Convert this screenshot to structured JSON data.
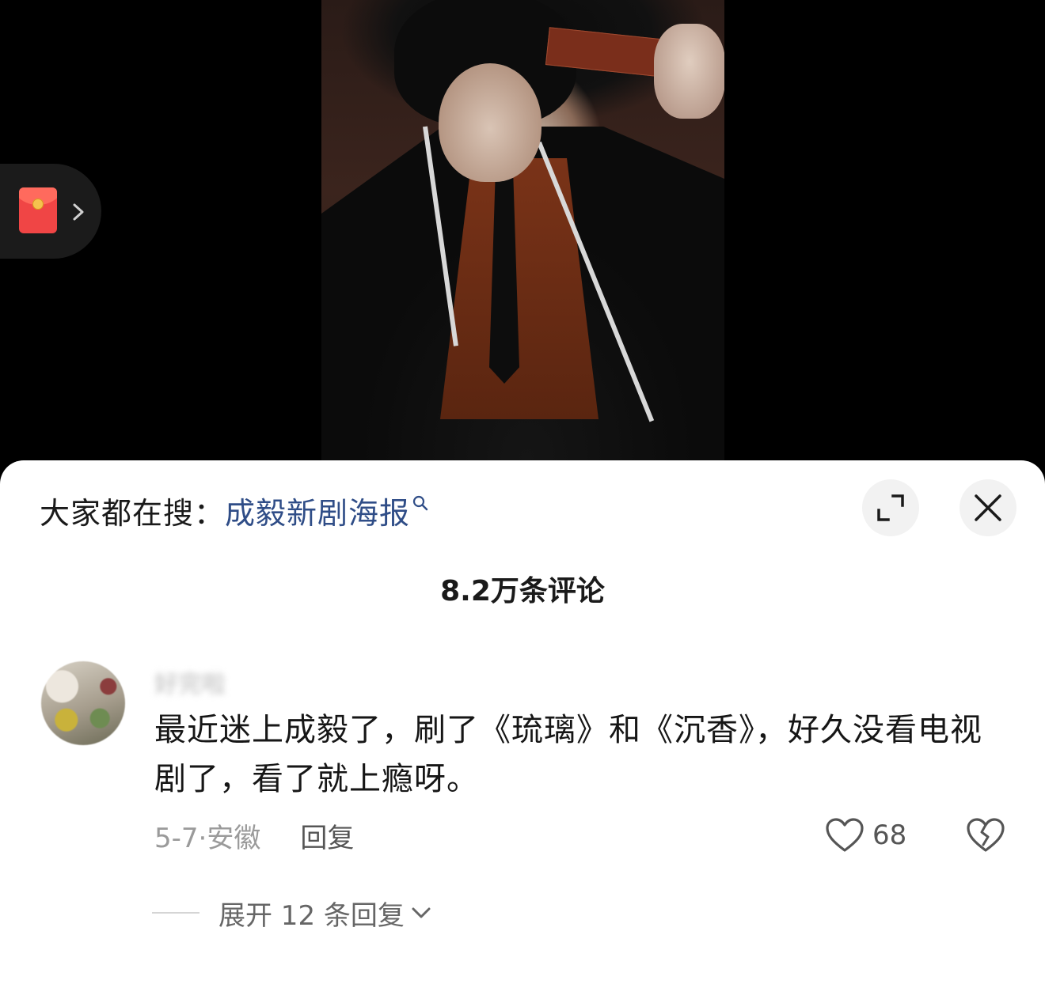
{
  "redpacket": {
    "icon": "red-packet-icon",
    "chevron": "chevron-right-icon"
  },
  "search": {
    "prefix": "大家都在搜：",
    "term": "成毅新剧海报",
    "icon": "search-icon",
    "term_color": "#2f4d87"
  },
  "header": {
    "comment_count": "8.2万条评论",
    "expand_icon": "expand-icon",
    "close_icon": "close-icon"
  },
  "comment": {
    "username": "好完啦",
    "text": "最近迷上成毅了，刷了《琉璃》和《沉香》，好久没看电视剧了，看了就上瘾呀。",
    "date_location": "5-7·安徽",
    "reply_label": "回复",
    "like_count": "68",
    "like_icon": "heart-outline-icon",
    "dislike_icon": "broken-heart-icon"
  },
  "replies": {
    "expand_label": "展开 12 条回复",
    "chevron": "chevron-down-icon"
  }
}
